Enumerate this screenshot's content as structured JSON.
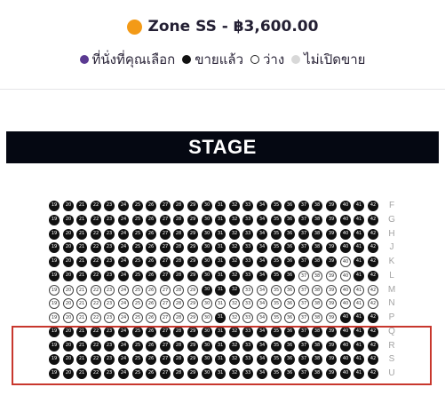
{
  "zone": {
    "title": "Zone SS - ฿3,600.00",
    "color": "#f39a17"
  },
  "legend": [
    {
      "label": "ที่นั่งที่คุณเลือก",
      "icon": "selected-seat-swatch",
      "color": "#5b3a92"
    },
    {
      "label": "ขายแล้ว",
      "icon": "sold-seat-swatch",
      "color": "#111111"
    },
    {
      "label": "ว่าง",
      "icon": "available-seat-swatch",
      "color": "#ffffff"
    },
    {
      "label": "ไม่เปิดขาย",
      "icon": "unavailable-seat-swatch",
      "color": "#d8d8d8"
    }
  ],
  "stage": {
    "label": "STAGE",
    "background": "#050812",
    "text_color": "#ffffff"
  },
  "seatmap": {
    "seat_numbers": [
      19,
      20,
      21,
      22,
      23,
      24,
      25,
      26,
      27,
      28,
      29,
      30,
      31,
      32,
      33,
      34,
      35,
      36,
      37,
      38,
      39,
      40,
      41,
      42
    ],
    "rows": [
      "F",
      "G",
      "H",
      "J",
      "K",
      "L",
      "M",
      "N",
      "P",
      "Q",
      "R",
      "S",
      "U"
    ],
    "sold_color": "#111111",
    "open_seats": {
      "K": [
        40
      ],
      "L": [
        37,
        38,
        39,
        40
      ],
      "M": [
        19,
        20,
        21,
        22,
        23,
        24,
        25,
        26,
        27,
        28,
        29,
        33,
        34,
        35,
        36,
        37,
        38,
        39,
        40,
        41,
        42
      ],
      "N": [
        19,
        20,
        21,
        22,
        23,
        24,
        25,
        26,
        27,
        28,
        29,
        30,
        31,
        32,
        33,
        34,
        35,
        36,
        37,
        38,
        39,
        40,
        41,
        42
      ],
      "P": [
        19,
        20,
        21,
        22,
        23,
        24,
        25,
        26,
        27,
        28,
        29,
        30,
        32,
        33,
        34,
        35,
        36,
        37,
        38,
        39
      ]
    },
    "blocked_seats": {}
  }
}
